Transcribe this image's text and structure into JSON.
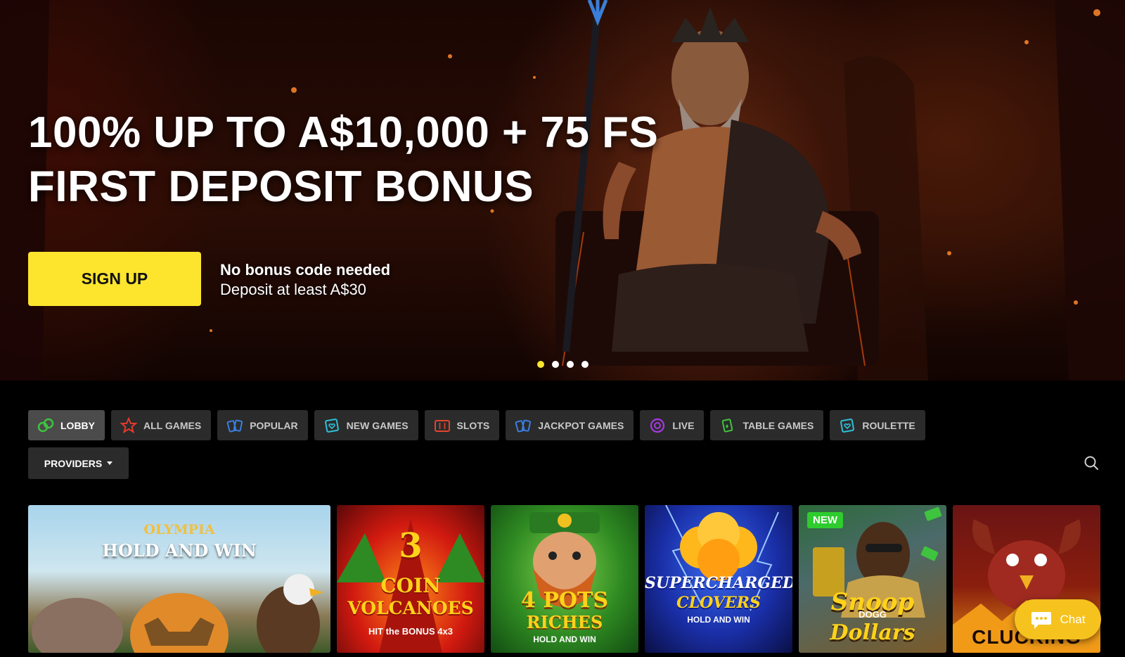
{
  "hero": {
    "headline_line1": "100% UP TO A$10,000 + 75 FS",
    "headline_line2": "FIRST DEPOSIT BONUS",
    "cta_label": "SIGN UP",
    "note_strong": "No bonus code needed",
    "note_sub": "Deposit at least A$30",
    "slides_total": 4,
    "active_slide": 1
  },
  "tabs": [
    {
      "label": "LOBBY",
      "icon": "lobby-icon",
      "active": true
    },
    {
      "label": "ALL GAMES",
      "icon": "star-icon",
      "active": false
    },
    {
      "label": "POPULAR",
      "icon": "cards-icon",
      "active": false
    },
    {
      "label": "NEW GAMES",
      "icon": "heart-card-icon",
      "active": false
    },
    {
      "label": "SLOTS",
      "icon": "slot-machine-icon",
      "active": false
    },
    {
      "label": "JACKPOT GAMES",
      "icon": "cards-icon",
      "active": false
    },
    {
      "label": "LIVE",
      "icon": "live-chip-icon",
      "active": false
    },
    {
      "label": "TABLE GAMES",
      "icon": "table-cards-icon",
      "active": false
    },
    {
      "label": "ROULETTE",
      "icon": "heart-card-icon",
      "active": false
    }
  ],
  "providers": {
    "label": "PROVIDERS"
  },
  "games": [
    {
      "line1": "OLYMPIA",
      "line2": "HOLD AND WIN"
    },
    {
      "line1": "3",
      "line2": "COIN",
      "line3": "VOLCANOES",
      "line4": "HIT the BONUS 4x3"
    },
    {
      "line1": "4 POTS",
      "line2": "RICHES",
      "line3": "HOLD AND WIN"
    },
    {
      "line1": "SUPERCHARGED",
      "line2": "CLOVERS",
      "line3": "HOLD AND WIN"
    },
    {
      "badge": "NEW",
      "line1": "Snoop",
      "line2": "DOGG",
      "line3": "Dollars"
    },
    {
      "line1": "CLUCKING HELL"
    }
  ],
  "chat": {
    "label": "Chat"
  },
  "colors": {
    "accent": "#fde52e",
    "chat": "#f6c21e",
    "new_badge": "#2ecc2e",
    "tab_bg": "#2b2b2b"
  }
}
